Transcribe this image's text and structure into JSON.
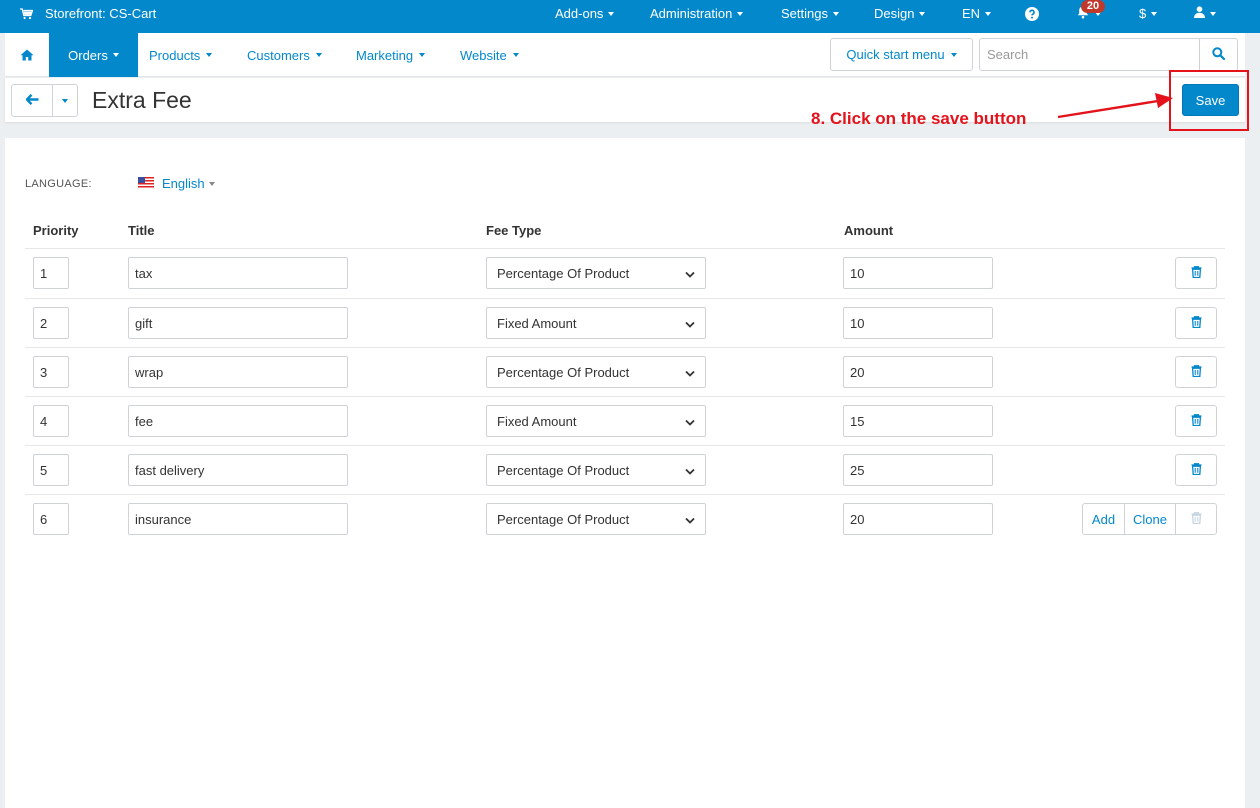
{
  "topbar": {
    "store": "Storefront: CS-Cart",
    "menu": [
      "Add-ons",
      "Administration",
      "Settings",
      "Design",
      "EN"
    ],
    "notification_count": "20",
    "currency": "$"
  },
  "nav": {
    "orders": "Orders",
    "items": [
      "Products",
      "Customers",
      "Marketing",
      "Website"
    ],
    "quick_start": "Quick start menu",
    "search_placeholder": "Search"
  },
  "page": {
    "title": "Extra Fee",
    "save_label": "Save"
  },
  "annotation": {
    "text": "8. Click on the save button",
    "color": "#e3121b"
  },
  "language": {
    "label": "LANGUAGE:",
    "value": "English"
  },
  "table": {
    "headers": [
      "Priority",
      "Title",
      "Fee Type",
      "Amount"
    ],
    "rows": [
      {
        "priority": "1",
        "title": "tax",
        "fee_type": "Percentage Of Product",
        "amount": "10"
      },
      {
        "priority": "2",
        "title": "gift",
        "fee_type": "Fixed Amount",
        "amount": "10"
      },
      {
        "priority": "3",
        "title": "wrap",
        "fee_type": "Percentage Of Product",
        "amount": "20"
      },
      {
        "priority": "4",
        "title": "fee",
        "fee_type": "Fixed Amount",
        "amount": "15"
      },
      {
        "priority": "5",
        "title": "fast delivery",
        "fee_type": "Percentage Of Product",
        "amount": "25"
      },
      {
        "priority": "6",
        "title": "insurance",
        "fee_type": "Percentage Of Product",
        "amount": "20"
      }
    ],
    "add_label": "Add",
    "clone_label": "Clone"
  },
  "colors": {
    "accent": "#0388cc",
    "annotation": "#e3121b",
    "badge": "#c0392b"
  }
}
